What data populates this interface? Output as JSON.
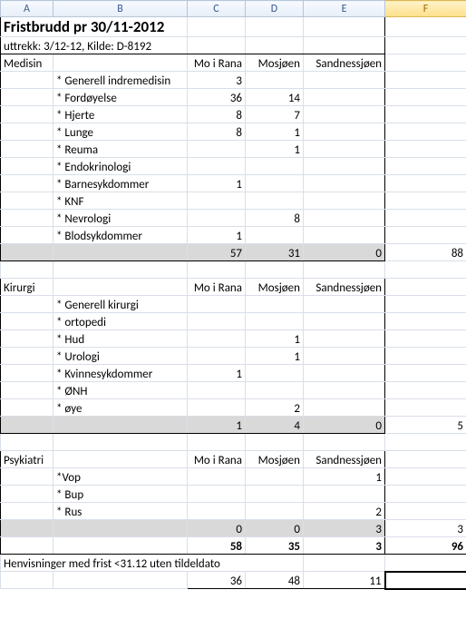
{
  "columns": {
    "a": "A",
    "b": "B",
    "c": "C",
    "d": "D",
    "e": "E",
    "f": "F"
  },
  "title": "Fristbrudd pr 30/11-2012",
  "subtitle": "uttrekk: 3/12-12, Kilde: D-8192",
  "headers": {
    "c": "Mo i Rana",
    "d": "Mosjøen",
    "e": "Sandnessjøen"
  },
  "sections": {
    "medisin": {
      "label": "Medisin",
      "rows": [
        {
          "label": "* Generell indremedisin",
          "c": "3",
          "d": "",
          "e": ""
        },
        {
          "label": "* Fordøyelse",
          "c": "36",
          "d": "14",
          "e": ""
        },
        {
          "label": "* Hjerte",
          "c": "8",
          "d": "7",
          "e": ""
        },
        {
          "label": "* Lunge",
          "c": "8",
          "d": "1",
          "e": ""
        },
        {
          "label": "* Reuma",
          "c": "",
          "d": "1",
          "e": ""
        },
        {
          "label": "* Endokrinologi",
          "c": "",
          "d": "",
          "e": ""
        },
        {
          "label": "* Barnesykdommer",
          "c": "1",
          "d": "",
          "e": ""
        },
        {
          "label": "* KNF",
          "c": "",
          "d": "",
          "e": ""
        },
        {
          "label": "* Nevrologi",
          "c": "",
          "d": "8",
          "e": ""
        },
        {
          "label": "* Blodsykdommer",
          "c": "1",
          "d": "",
          "e": ""
        }
      ],
      "subtotal": {
        "c": "57",
        "d": "31",
        "e": "0",
        "f": "88"
      }
    },
    "kirurgi": {
      "label": "Kirurgi",
      "rows": [
        {
          "label": "* Generell kirurgi",
          "c": "",
          "d": "",
          "e": ""
        },
        {
          "label": "* ortopedi",
          "c": "",
          "d": "",
          "e": ""
        },
        {
          "label": "* Hud",
          "c": "",
          "d": "1",
          "e": ""
        },
        {
          "label": "* Urologi",
          "c": "",
          "d": "1",
          "e": ""
        },
        {
          "label": "* Kvinnesykdommer",
          "c": "1",
          "d": "",
          "e": ""
        },
        {
          "label": "* ØNH",
          "c": "",
          "d": "",
          "e": ""
        },
        {
          "label": "* øye",
          "c": "",
          "d": "2",
          "e": ""
        }
      ],
      "subtotal": {
        "c": "1",
        "d": "4",
        "e": "0",
        "f": "5"
      }
    },
    "psykiatri": {
      "label": "Psykiatri",
      "rows": [
        {
          "label": "*Vop",
          "c": "",
          "d": "",
          "e": "1"
        },
        {
          "label": "* Bup",
          "c": "",
          "d": "",
          "e": ""
        },
        {
          "label": "* Rus",
          "c": "",
          "d": "",
          "e": "2"
        }
      ],
      "subtotal": {
        "c": "0",
        "d": "0",
        "e": "3",
        "f": "3"
      }
    }
  },
  "grandtotal": {
    "c": "58",
    "d": "35",
    "e": "3",
    "f": "96"
  },
  "footer": {
    "label": "Henvisninger med frist <31.12 uten tildeldato",
    "c": "36",
    "d": "48",
    "e": "11"
  }
}
